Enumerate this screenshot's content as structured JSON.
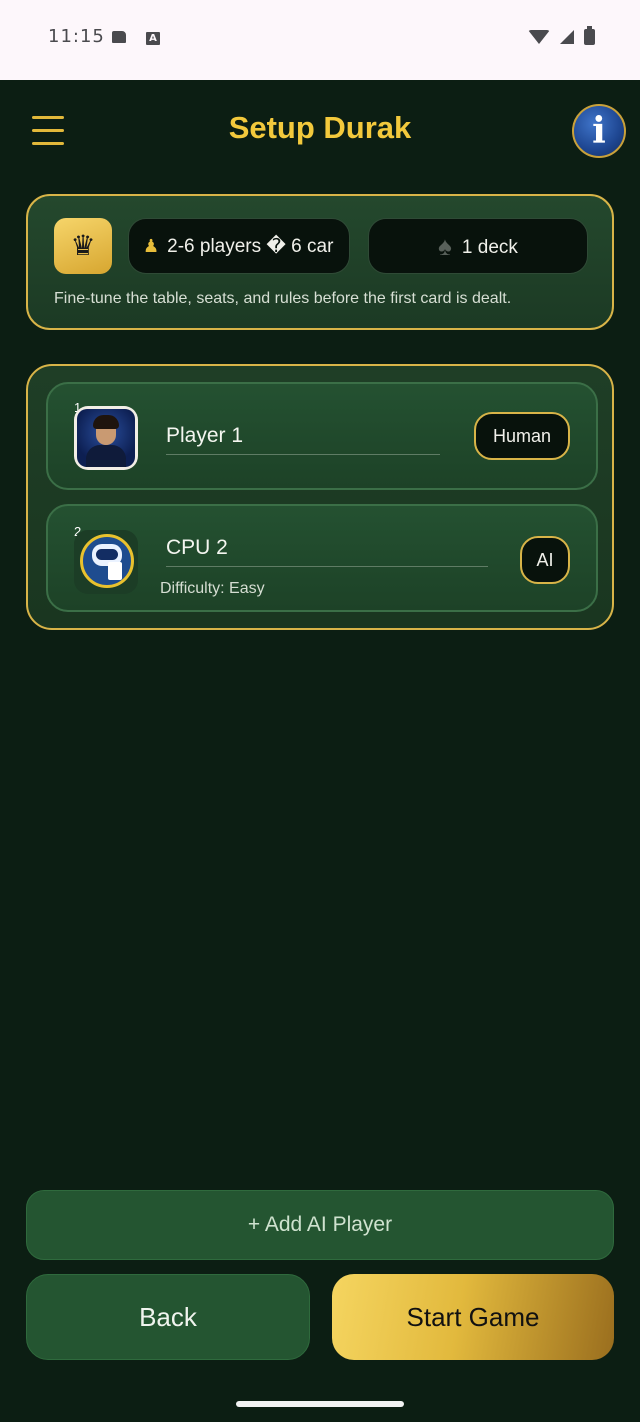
{
  "status_bar": {
    "time": "11:15",
    "a_icon": "A"
  },
  "header": {
    "title": "Setup Durak",
    "menu_icon": "hamburger-menu-icon",
    "info_icon": "i"
  },
  "info_card": {
    "crown_icon": "♛",
    "players_chip": "2-6 players � 6 car",
    "pawn_icon": "♟",
    "deck_chip": "1 deck",
    "spade_icon": "♠",
    "description": "Fine-tune the table, seats, and rules before the first card is dealt."
  },
  "players": [
    {
      "seat": "1",
      "name": "Player 1",
      "type": "Human"
    },
    {
      "seat": "2",
      "name": "CPU 2",
      "type": "AI",
      "difficulty": "Difficulty: Easy"
    }
  ],
  "actions": {
    "add_ai": "+ Add AI Player",
    "back": "Back",
    "start": "Start Game"
  },
  "colors": {
    "accent_gold": "#f3c93c",
    "background": "#0c1e13",
    "card_green": "#245131"
  }
}
